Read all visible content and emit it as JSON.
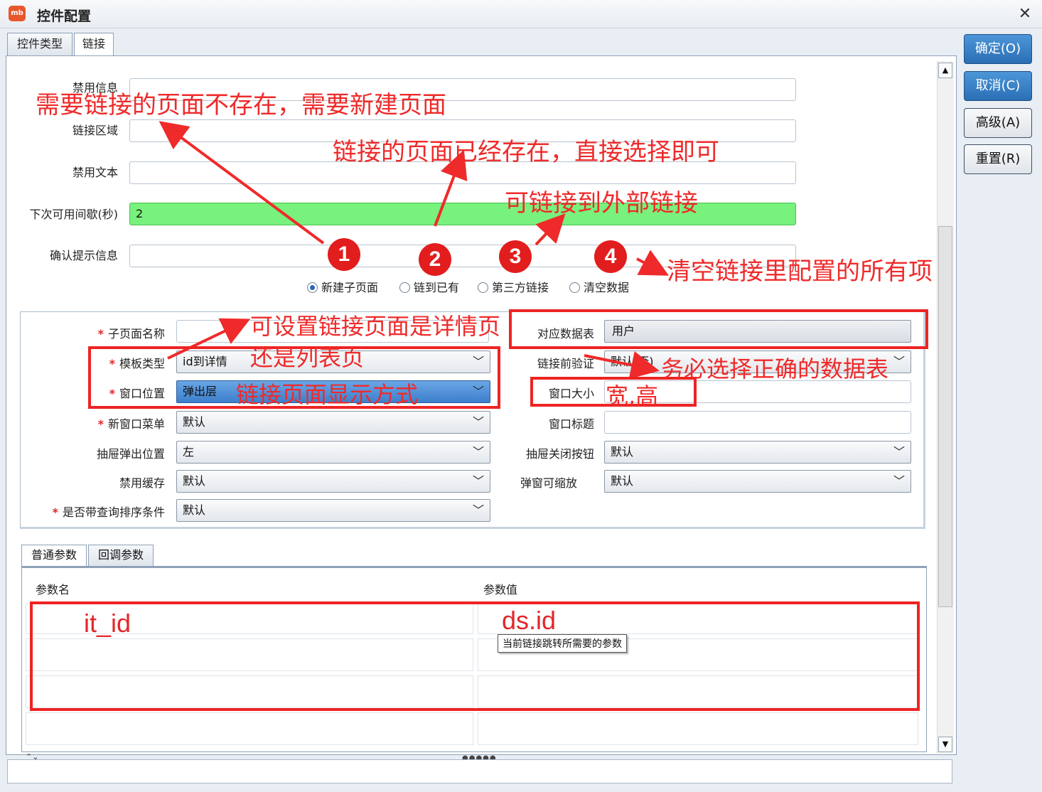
{
  "window": {
    "app_icon": "mb",
    "title": "控件配置",
    "close_icon": "✕"
  },
  "top_tabs": [
    {
      "label": "控件类型",
      "active": false
    },
    {
      "label": "链接",
      "active": true
    }
  ],
  "side_buttons": [
    {
      "label": "确定(O)",
      "primary": true
    },
    {
      "label": "取消(C)",
      "primary": true
    },
    {
      "label": "高级(A)",
      "primary": false
    },
    {
      "label": "重置(R)",
      "primary": false
    }
  ],
  "fields": {
    "disabled_info": {
      "label": "禁用信息",
      "value": ""
    },
    "link_area": {
      "label": "链接区域",
      "value": ""
    },
    "disabled_text": {
      "label": "禁用文本",
      "value": ""
    },
    "next_interval": {
      "label": "下次可用间歇(秒)",
      "value": "2"
    },
    "confirm_msg": {
      "label": "确认提示信息",
      "value": ""
    }
  },
  "radio_options": [
    {
      "label": "新建子页面",
      "checked": true
    },
    {
      "label": "链到已有",
      "checked": false
    },
    {
      "label": "第三方链接",
      "checked": false
    },
    {
      "label": "清空数据",
      "checked": false
    }
  ],
  "subpage": {
    "name_label": "子页面名称",
    "name_value": "",
    "template_label": "模板类型",
    "template_value": "id到详情",
    "window_pos_label": "窗口位置",
    "window_pos_value": "弹出层",
    "new_window_menu_label": "新窗口菜单",
    "new_window_menu_value": "默认",
    "drawer_pos_label": "抽屉弹出位置",
    "drawer_pos_value": "左",
    "disable_cache_label": "禁用缓存",
    "disable_cache_value": "默认",
    "query_sort_label": "是否带查询排序条件",
    "query_sort_value": "默认",
    "datatable_label": "对应数据表",
    "datatable_value": "用户",
    "prelink_check_label": "链接前验证",
    "prelink_check_value": "默认(否)",
    "window_size_label": "窗口大小",
    "window_size_value": "",
    "window_title_label": "窗口标题",
    "window_title_value": "",
    "drawer_close_label": "抽屉关闭按钮",
    "drawer_close_value": "默认",
    "popup_zoom_label": "弹窗可缩放",
    "popup_zoom_value": "默认",
    "required_mark": "*"
  },
  "param_tabs": [
    {
      "label": "普通参数",
      "active": true
    },
    {
      "label": "回调参数",
      "active": false
    }
  ],
  "param_table": {
    "headers": [
      "参数名",
      "参数值"
    ],
    "tooltip": "当前链接跳转所需要的参数"
  },
  "annotations": {
    "a1": "需要链接的页面不存在，需要新建页面",
    "a2": "链接的页面已经存在，直接选择即可",
    "a3": "可链接到外部链接",
    "a4": "清空链接里配置的所有项",
    "a5_line1": "可设置链接页面是详情页",
    "a5_line2": "还是列表页",
    "a6": "链接页面显示方式",
    "a7": "务必选择正确的数据表",
    "a8": "宽,高",
    "param_name": "it_id",
    "param_value": "ds.id",
    "num1": "1",
    "num2": "2",
    "num3": "3",
    "num4": "4"
  },
  "colors": {
    "annotation_red": "#ef2a2a",
    "field_green": "#78f17d",
    "primary_blue": "#2b6fb5"
  },
  "icons": {
    "close": "close-icon",
    "chevron": "chevron-down-icon",
    "radio": "radio-icon",
    "app": "app-logo-icon"
  },
  "glyphs": {
    "chevron": "﹀",
    "scroll_up": "▲",
    "scroll_down": "▼",
    "grip": "●●●●●",
    "resize": "⌃⌄"
  }
}
